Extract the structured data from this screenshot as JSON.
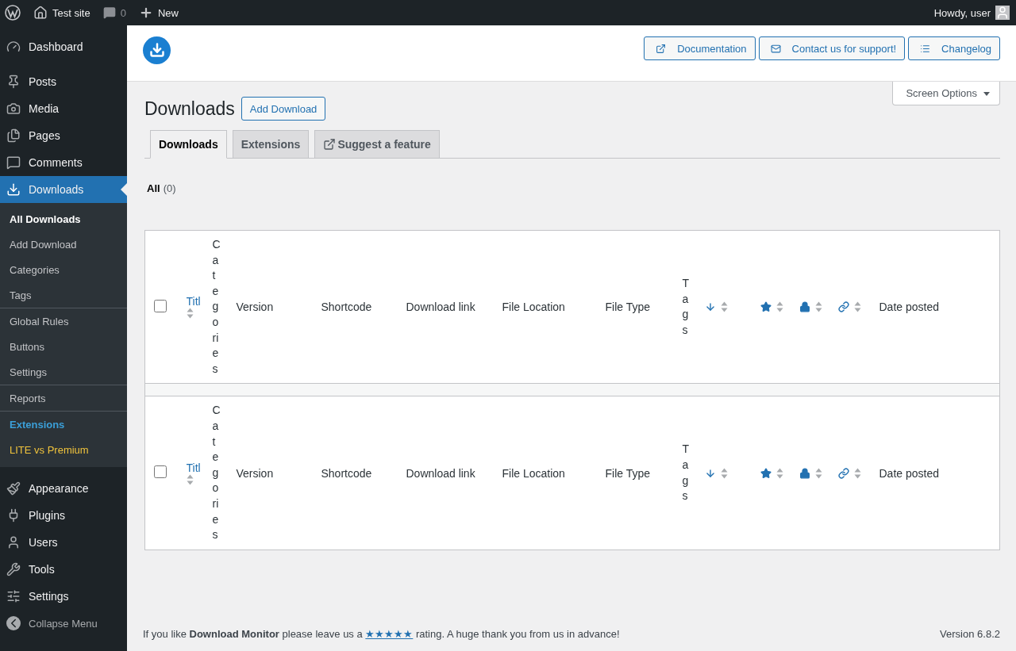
{
  "admin_bar": {
    "site": "Test site",
    "comments": "0",
    "new": "New",
    "greeting": "Howdy, user"
  },
  "sidebar": {
    "items": [
      {
        "label": "Dashboard",
        "selected": false
      },
      {
        "label": "Posts",
        "selected": false
      },
      {
        "label": "Media",
        "selected": false
      },
      {
        "label": "Pages",
        "selected": false
      },
      {
        "label": "Comments",
        "selected": false
      },
      {
        "label": "Downloads",
        "selected": true,
        "submenu": [
          [
            {
              "label": "All Downloads",
              "selected": true,
              "kind": "normal"
            },
            {
              "label": "Add Download",
              "selected": false,
              "kind": "normal"
            },
            {
              "label": "Categories",
              "selected": false,
              "kind": "normal"
            },
            {
              "label": "Tags",
              "selected": false,
              "kind": "normal"
            }
          ],
          [
            {
              "label": "Global Rules",
              "selected": false,
              "kind": "normal"
            },
            {
              "label": "Buttons",
              "selected": false,
              "kind": "normal"
            },
            {
              "label": "Settings",
              "selected": false,
              "kind": "normal"
            }
          ],
          [
            {
              "label": "Reports",
              "selected": false,
              "kind": "normal"
            }
          ],
          [
            {
              "label": "Extensions",
              "selected": false,
              "kind": "highlight"
            },
            {
              "label": "LITE vs Premium",
              "selected": false,
              "kind": "promo"
            }
          ]
        ]
      },
      {
        "label": "Appearance",
        "selected": false
      },
      {
        "label": "Plugins",
        "selected": false
      },
      {
        "label": "Users",
        "selected": false
      },
      {
        "label": "Tools",
        "selected": false
      },
      {
        "label": "Settings",
        "selected": false
      }
    ],
    "collapse": "Collapse Menu"
  },
  "header_buttons": [
    "Documentation",
    "Contact us for support!",
    "Changelog"
  ],
  "screen_options": "Screen Options",
  "page_title": "Downloads",
  "add_button": "Add Download",
  "tabs": [
    {
      "label": "Downloads",
      "selected": true,
      "external": false
    },
    {
      "label": "Extensions",
      "selected": false,
      "external": false
    },
    {
      "label": "Suggest a feature",
      "selected": false,
      "external": true
    }
  ],
  "filter": {
    "label": "All",
    "count": "(0)"
  },
  "table": {
    "header": {
      "checked": false,
      "columns": [
        {
          "kind": "link",
          "label": "Titl",
          "sortable": true
        },
        {
          "kind": "narrow",
          "label": "Categories"
        },
        {
          "kind": "text",
          "label": "Version"
        },
        {
          "kind": "text",
          "label": "Shortcode"
        },
        {
          "kind": "text",
          "label": "Download link"
        },
        {
          "kind": "text",
          "label": "File Location"
        },
        {
          "kind": "text",
          "label": "File Type"
        },
        {
          "kind": "narrow",
          "label": "Tags"
        },
        {
          "kind": "icon",
          "sortable": true
        },
        {
          "kind": "icon",
          "sortable": true
        },
        {
          "kind": "icon",
          "sortable": true
        },
        {
          "kind": "icon",
          "sortable": true
        },
        {
          "kind": "text",
          "label": "Date posted"
        }
      ]
    },
    "footer": {
      "checked": false,
      "columns": [
        {
          "kind": "link",
          "label": "Titl",
          "sortable": true
        },
        {
          "kind": "narrow",
          "label": "Categories"
        },
        {
          "kind": "text",
          "label": "Version"
        },
        {
          "kind": "text",
          "label": "Shortcode"
        },
        {
          "kind": "text",
          "label": "Download link"
        },
        {
          "kind": "text",
          "label": "File Location"
        },
        {
          "kind": "text",
          "label": "File Type"
        },
        {
          "kind": "narrow",
          "label": "Tags"
        },
        {
          "kind": "icon",
          "sortable": true
        },
        {
          "kind": "icon",
          "sortable": true
        },
        {
          "kind": "icon",
          "sortable": true
        },
        {
          "kind": "icon",
          "sortable": true
        },
        {
          "kind": "text",
          "label": "Date posted"
        }
      ]
    }
  },
  "footer": {
    "before": "If you like **Download Monitor** please leave us a",
    "link": "★★★★★",
    "after": "rating. A huge thank you from us in advance!",
    "version": "Version 6.8.2"
  }
}
